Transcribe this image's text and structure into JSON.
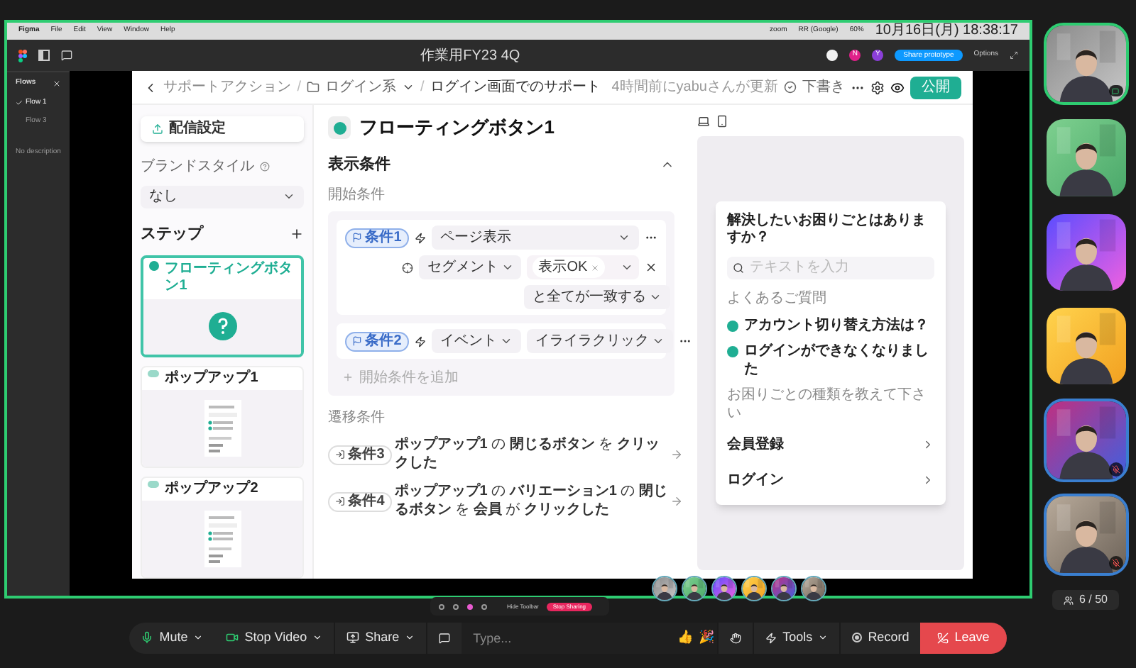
{
  "menu_bar": {
    "app": "Figma",
    "menus": [
      "File",
      "Edit",
      "View",
      "Window",
      "Help"
    ],
    "status_items": [
      "zoom",
      "RR (Google)",
      "60%"
    ],
    "clock": "10月16日(月) 18:38:17"
  },
  "figma_toolbar": {
    "file_name": "作業用FY23 4Q",
    "collaborators": [
      {
        "color": "#f2f2f2"
      },
      {
        "initial": "N",
        "color": "#e0218a"
      },
      {
        "initial": "Y",
        "color": "#8b3fd9"
      }
    ],
    "share_button": "Share prototype",
    "options": "Options"
  },
  "flows_panel": {
    "title": "Flows",
    "flows": [
      {
        "label": "Flow 1",
        "selected": true
      },
      {
        "label": "Flow 3",
        "selected": false
      }
    ],
    "description": "No description"
  },
  "app": {
    "breadcrumb": [
      "サポートアクション",
      "ログイン系",
      "ログイン画面でのサポート"
    ],
    "breadcrumb_separators": [
      "/",
      "/"
    ],
    "updated": "4時間前にyabuさんが更新",
    "status": "下書き",
    "publish_button": "公開",
    "sidebar": {
      "delivery_button": "配信設定",
      "brand_style_label": "ブランドスタイル",
      "brand_style_value": "なし",
      "steps_title": "ステップ",
      "steps": [
        {
          "title": "フローティングボタン1",
          "kind": "floating",
          "selected": true
        },
        {
          "title": "ポップアップ1",
          "kind": "popup",
          "selected": false
        },
        {
          "title": "ポップアップ2",
          "kind": "popup",
          "selected": false
        }
      ]
    },
    "editor": {
      "title": "フローティングボタン1",
      "section_title": "表示条件",
      "expanded": true,
      "start_label": "開始条件",
      "start_conditions": [
        {
          "badge": "条件1",
          "event": "ページ表示",
          "filter": {
            "type": "セグメント",
            "tag": "表示OK",
            "match": "と全てが一致する"
          }
        },
        {
          "badge": "条件2",
          "event": "イベント",
          "value": "イライラクリック"
        }
      ],
      "add_condition": "開始条件を追加",
      "transition_label": "遷移条件",
      "transition_conditions": [
        {
          "badge": "条件3",
          "text": "**ポップアップ1** の **閉じるボタン** を **クリックした**"
        },
        {
          "badge": "条件4",
          "text": "**ポップアップ1** の **バリエーション1** の **閉じるボタン** を **会員** が **クリックした**"
        }
      ]
    },
    "widget": {
      "title": "解決したいお困りごとはありますか？",
      "search_placeholder": "テキストを入力",
      "faq_label": "よくあるご質問",
      "faq": [
        "アカウント切り替え方法は？",
        "ログインができなくなりました"
      ],
      "category_label": "お困りごとの種類を教えて下さい",
      "categories": [
        "会員登録",
        "ログイン"
      ]
    }
  },
  "share_toolbar": {
    "hide": "Hide Toolbar",
    "stop": "Stop Sharing"
  },
  "participants": {
    "tiles": [
      {
        "speaking": true,
        "muted": false,
        "badge": true
      },
      {
        "speaking": false,
        "muted": false,
        "badge": false
      },
      {
        "speaking": false,
        "muted": false,
        "badge": false
      },
      {
        "speaking": false,
        "muted": false,
        "badge": false
      },
      {
        "speaking": false,
        "muted": true,
        "badge": false
      },
      {
        "speaking": false,
        "muted": true,
        "badge": false
      }
    ],
    "count": "6 / 50"
  },
  "toolbar": {
    "mute": "Mute",
    "video": "Stop Video",
    "share": "Share",
    "chat_placeholder": "Type...",
    "reactions": [
      "👍",
      "🎉"
    ],
    "tools": "Tools",
    "record": "Record",
    "leave": "Leave"
  }
}
